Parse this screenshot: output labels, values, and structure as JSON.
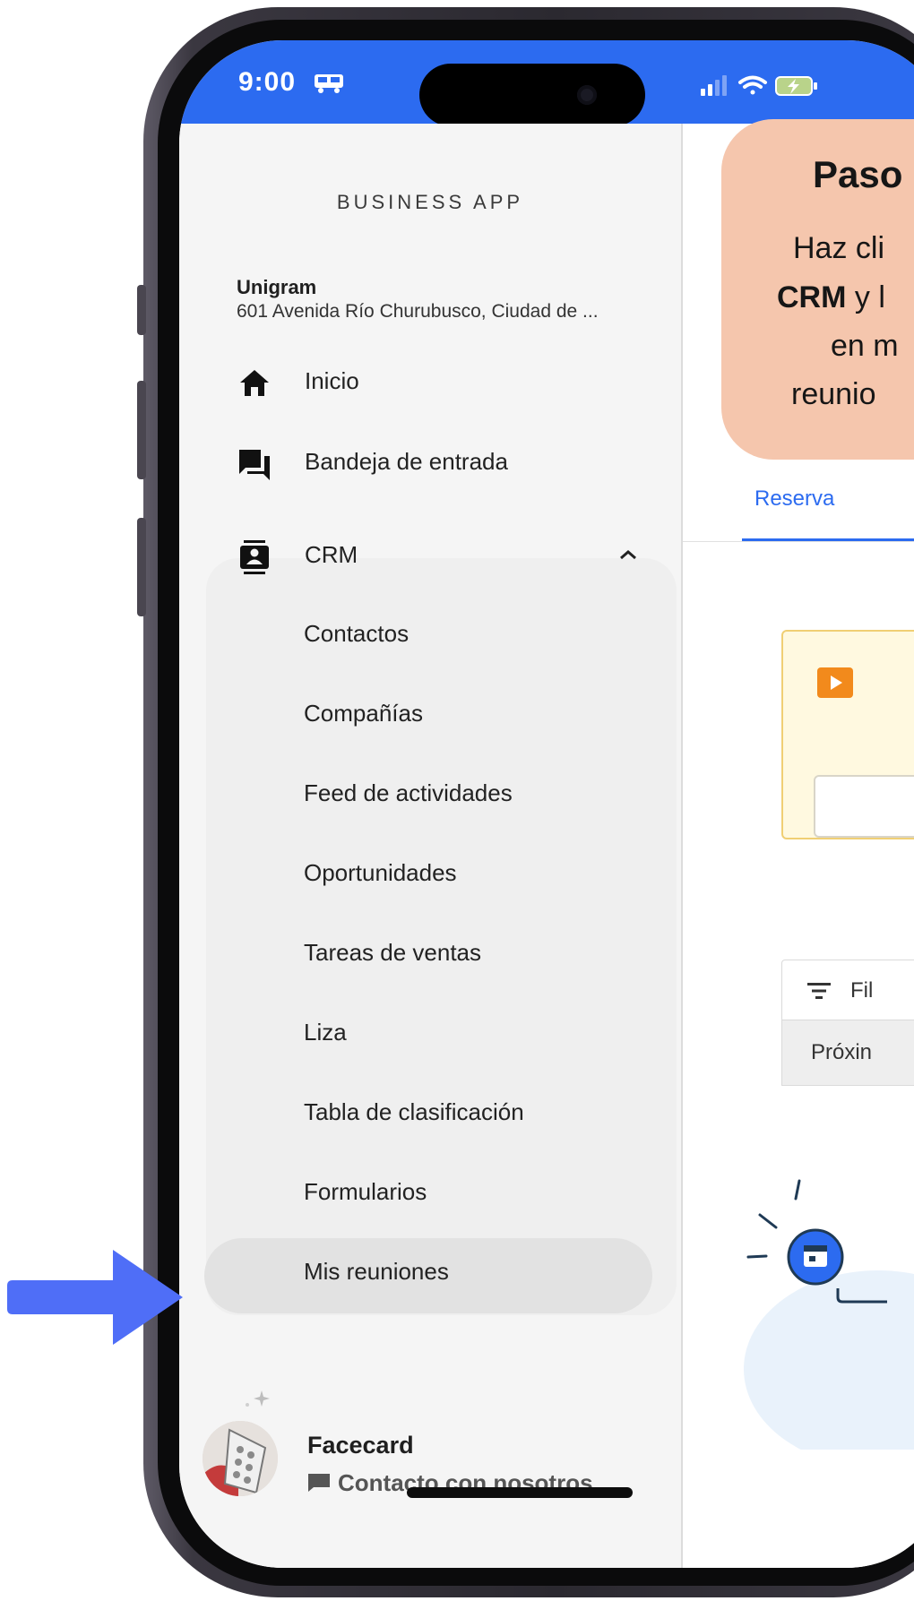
{
  "status_bar": {
    "time": "9:00"
  },
  "drawer": {
    "title": "BUSINESS APP",
    "company_name": "Unigram",
    "company_address": "601 Avenida Río Churubusco, Ciudad de ...",
    "nav": [
      {
        "label": "Inicio",
        "icon": "home-icon"
      },
      {
        "label": "Bandeja de entrada",
        "icon": "chat-bubbles-icon"
      },
      {
        "label": "CRM",
        "icon": "contacts-card-icon",
        "expanded": true
      }
    ],
    "crm_items": [
      {
        "label": "Contactos"
      },
      {
        "label": "Compañías"
      },
      {
        "label": "Feed de actividades"
      },
      {
        "label": "Oportunidades"
      },
      {
        "label": "Tareas de ventas"
      },
      {
        "label": "Liza"
      },
      {
        "label": "Tabla de clasificación"
      },
      {
        "label": "Formularios"
      },
      {
        "label": "Mis reuniones",
        "selected": true
      }
    ],
    "user": {
      "name": "Facecard",
      "contact_label": "Contacto con nosotros"
    }
  },
  "background_app": {
    "tab_label": "Reserva",
    "filter_label": "Fil",
    "next_label": "Próxin"
  },
  "callout": {
    "title": "Paso",
    "line1": "Haz cli",
    "line2_bold": "CRM",
    "line2_rest": " y l",
    "line3": "en m",
    "line4": "reunio"
  },
  "colors": {
    "status_bar": "#2c6bf0",
    "callout_bg": "#f5c6ad",
    "arrow": "#4f6ef7",
    "drawer_bg": "#f5f5f5",
    "selected_pill": "#e2e2e2",
    "accent_blue": "#2c6bf0",
    "warning_card": "#fff9e0",
    "play_orange": "#f28a1c"
  }
}
